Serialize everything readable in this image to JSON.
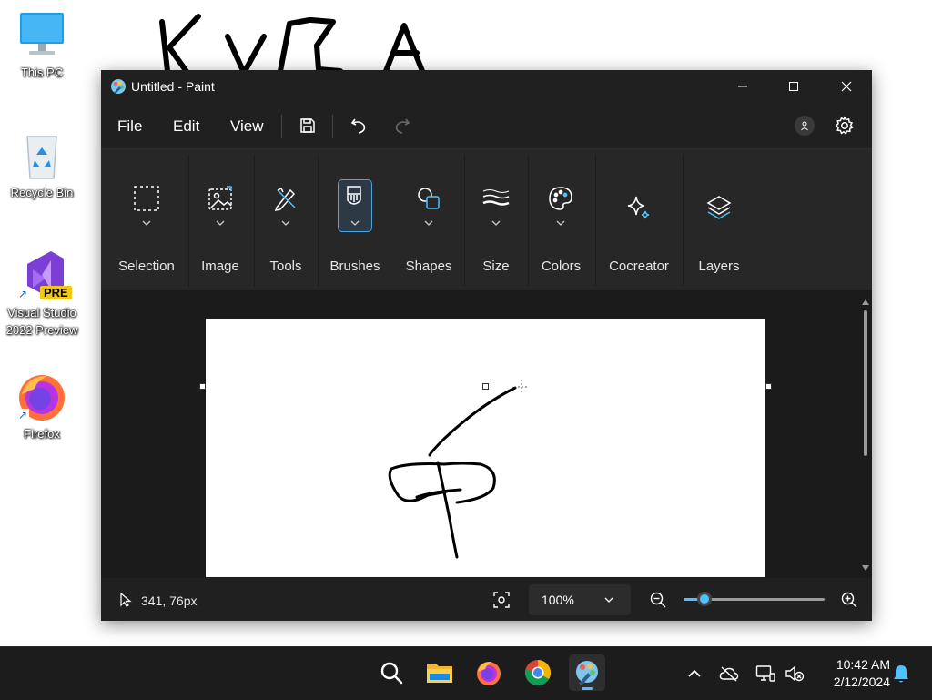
{
  "desktop": {
    "icons": [
      {
        "label": "This PC",
        "icon": "monitor-icon"
      },
      {
        "label": "Recycle Bin",
        "icon": "recycle-bin-icon"
      },
      {
        "label": "Visual Studio 2022 Preview",
        "label_line1": "Visual Studio",
        "label_line2": "2022 Preview",
        "icon": "visual-studio-icon",
        "badge": "PRE"
      },
      {
        "label": "Firefox",
        "icon": "firefox-icon"
      }
    ]
  },
  "window": {
    "title": "Untitled - Paint",
    "controls": {
      "minimize": "minimize-icon",
      "maximize": "maximize-icon",
      "close": "close-icon"
    }
  },
  "menubar": {
    "file": "File",
    "edit": "Edit",
    "view": "View",
    "icons": [
      "save-icon",
      "undo-icon",
      "redo-icon",
      "account-icon",
      "settings-icon"
    ]
  },
  "ribbon": {
    "groups": [
      {
        "label": "Selection",
        "icon": "selection-icon",
        "has_dropdown": true
      },
      {
        "label": "Image",
        "icon": "image-icon",
        "has_dropdown": true
      },
      {
        "label": "Tools",
        "icon": "tools-icon",
        "has_dropdown": true
      },
      {
        "label": "Brushes",
        "icon": "brush-icon",
        "has_dropdown": true,
        "selected": true
      },
      {
        "label": "Shapes",
        "icon": "shapes-icon",
        "has_dropdown": true
      },
      {
        "label": "Size",
        "icon": "size-icon",
        "has_dropdown": true
      },
      {
        "label": "Colors",
        "icon": "palette-icon",
        "has_dropdown": true
      },
      {
        "label": "Cocreator",
        "icon": "sparkle-icon",
        "has_dropdown": false
      },
      {
        "label": "Layers",
        "icon": "layers-icon",
        "has_dropdown": false
      }
    ]
  },
  "statusbar": {
    "cursor_position": "341, 76px",
    "zoom": {
      "value": "100%",
      "percent": 100,
      "slider_fraction": 0.15
    }
  },
  "taskbar": {
    "apps": [
      "search-icon",
      "file-explorer-icon",
      "firefox-icon",
      "chrome-icon",
      "paint-icon"
    ],
    "active_app": "paint-icon",
    "tray": [
      "chevron-up-icon",
      "onedrive-offline-icon",
      "network-icon",
      "volume-muted-icon",
      "notification-bell-icon"
    ],
    "time": "10:42 AM",
    "date": "2/12/2024"
  },
  "colors": {
    "accent": "#4cc2ff",
    "window_bg": "#202020",
    "ribbon_bg": "#272727",
    "canvas_bg": "#ffffff",
    "taskbar_bg": "#1c1c1c"
  }
}
